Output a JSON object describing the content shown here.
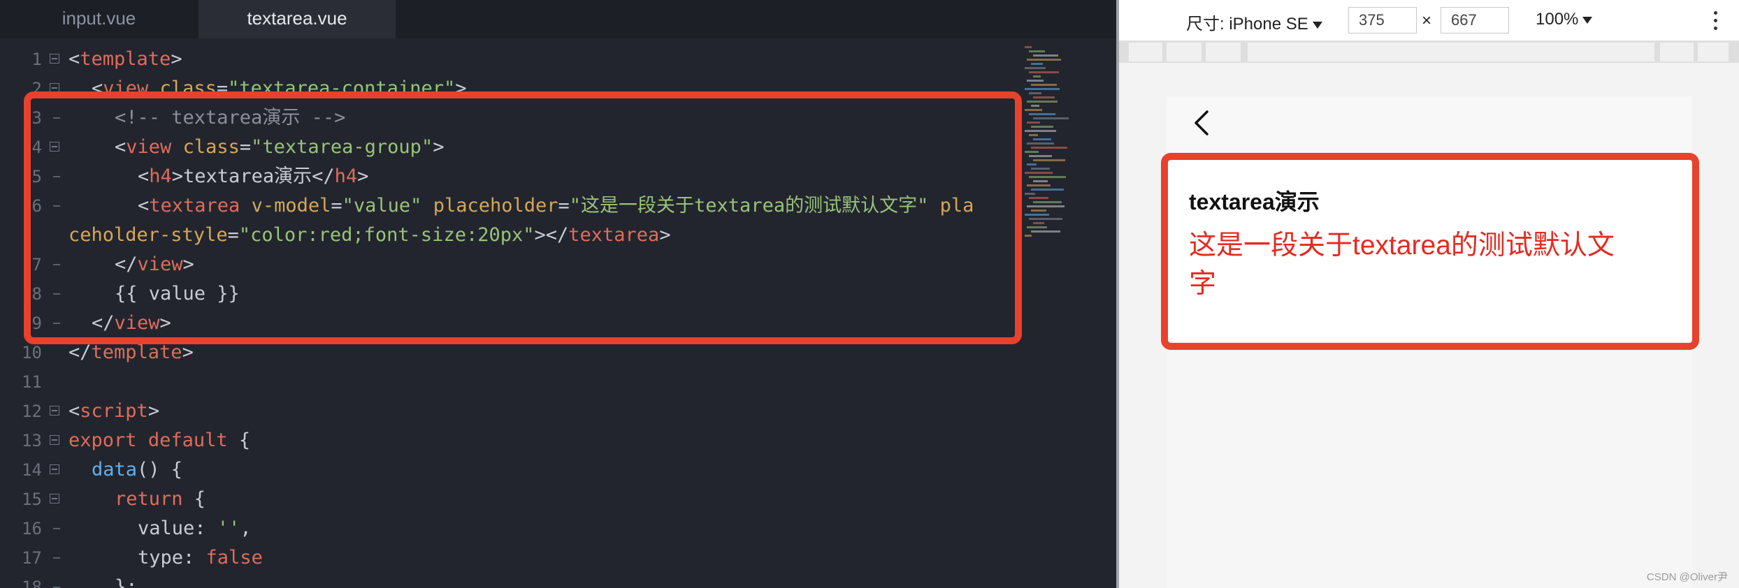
{
  "editor": {
    "tabs": [
      {
        "label": "input.vue",
        "active": false
      },
      {
        "label": "textarea.vue",
        "active": true
      }
    ],
    "lines": [
      {
        "n": "1",
        "fold": true,
        "indent": 0,
        "tokens": [
          [
            "p",
            "<"
          ],
          [
            "t",
            "template"
          ],
          [
            "p",
            ">"
          ]
        ]
      },
      {
        "n": "2",
        "fold": true,
        "indent": 1,
        "tokens": [
          [
            "p",
            "<"
          ],
          [
            "t",
            "view"
          ],
          [
            "p",
            " "
          ],
          [
            "a",
            "class"
          ],
          [
            "p",
            "="
          ],
          [
            "s",
            "\"textarea-container\""
          ],
          [
            "p",
            ">"
          ]
        ]
      },
      {
        "n": "3",
        "fold": false,
        "indent": 2,
        "tokens": [
          [
            "c",
            "<!-- textarea演示 -->"
          ]
        ]
      },
      {
        "n": "4",
        "fold": true,
        "indent": 2,
        "tokens": [
          [
            "p",
            "<"
          ],
          [
            "t",
            "view"
          ],
          [
            "p",
            " "
          ],
          [
            "a",
            "class"
          ],
          [
            "p",
            "="
          ],
          [
            "s",
            "\"textarea-group\""
          ],
          [
            "p",
            ">"
          ]
        ]
      },
      {
        "n": "5",
        "fold": false,
        "indent": 3,
        "tokens": [
          [
            "p",
            "<"
          ],
          [
            "t",
            "h4"
          ],
          [
            "p",
            ">textarea演示</"
          ],
          [
            "t",
            "h4"
          ],
          [
            "p",
            ">"
          ]
        ]
      },
      {
        "n": "6",
        "fold": false,
        "indent": 3,
        "tokens": [
          [
            "p",
            "<"
          ],
          [
            "t",
            "textarea"
          ],
          [
            "p",
            " "
          ],
          [
            "a",
            "v-model"
          ],
          [
            "p",
            "="
          ],
          [
            "s",
            "\"value\""
          ],
          [
            "p",
            " "
          ],
          [
            "a",
            "placeholder"
          ],
          [
            "p",
            "="
          ],
          [
            "s",
            "\"这是一段关于textarea的测试默认文字\""
          ],
          [
            "p",
            " "
          ],
          [
            "a",
            "pla"
          ]
        ]
      },
      {
        "n": "",
        "fold": false,
        "indent": 0,
        "tokens": [
          [
            "a",
            "ceholder-style"
          ],
          [
            "p",
            "="
          ],
          [
            "s",
            "\"color:red;font-size:20px\""
          ],
          [
            "p",
            "></"
          ],
          [
            "t",
            "textarea"
          ],
          [
            "p",
            ">"
          ]
        ]
      },
      {
        "n": "7",
        "fold": false,
        "indent": 2,
        "tokens": [
          [
            "p",
            "</"
          ],
          [
            "t",
            "view"
          ],
          [
            "p",
            ">"
          ]
        ]
      },
      {
        "n": "8",
        "fold": false,
        "indent": 2,
        "tokens": [
          [
            "p",
            "{{ value }}"
          ]
        ]
      },
      {
        "n": "9",
        "fold": false,
        "indent": 1,
        "tokens": [
          [
            "p",
            "</"
          ],
          [
            "t",
            "view"
          ],
          [
            "p",
            ">"
          ]
        ]
      },
      {
        "n": "10",
        "fold": false,
        "indent": 0,
        "tokens": [
          [
            "p",
            "</"
          ],
          [
            "t",
            "template"
          ],
          [
            "p",
            ">"
          ]
        ]
      },
      {
        "n": "11",
        "fold": false,
        "indent": 0,
        "tokens": []
      },
      {
        "n": "12",
        "fold": true,
        "indent": 0,
        "tokens": [
          [
            "p",
            "<"
          ],
          [
            "t",
            "script"
          ],
          [
            "p",
            ">"
          ]
        ]
      },
      {
        "n": "13",
        "fold": true,
        "indent": 0,
        "tokens": [
          [
            "k",
            "export"
          ],
          [
            "p",
            " "
          ],
          [
            "k",
            "default"
          ],
          [
            "p",
            " {"
          ]
        ]
      },
      {
        "n": "14",
        "fold": true,
        "indent": 1,
        "tokens": [
          [
            "f",
            "data"
          ],
          [
            "p",
            "() {"
          ]
        ]
      },
      {
        "n": "15",
        "fold": true,
        "indent": 2,
        "tokens": [
          [
            "k",
            "return"
          ],
          [
            "p",
            " {"
          ]
        ]
      },
      {
        "n": "16",
        "fold": false,
        "indent": 3,
        "tokens": [
          [
            "n",
            "value"
          ],
          [
            "p",
            ": "
          ],
          [
            "s",
            "''"
          ],
          [
            "p",
            ","
          ]
        ]
      },
      {
        "n": "17",
        "fold": false,
        "indent": 3,
        "tokens": [
          [
            "n",
            "type"
          ],
          [
            "p",
            ": "
          ],
          [
            "b",
            "false"
          ]
        ]
      },
      {
        "n": "18",
        "fold": false,
        "indent": 2,
        "tokens": [
          [
            "p",
            "};"
          ]
        ]
      }
    ]
  },
  "devtools": {
    "size_label": "尺寸: iPhone SE",
    "width_value": "375",
    "times": "×",
    "height_value": "667",
    "zoom": "100%"
  },
  "preview": {
    "back_icon": "chevron-left-icon",
    "title": "textarea演示",
    "placeholder": "这是一段关于textarea的测试默认文字",
    "placeholder_color": "#e32b20"
  },
  "watermark": "CSDN @Oliver尹",
  "colors": {
    "highlight": "#e8412c",
    "editor_bg": "#22252d"
  }
}
